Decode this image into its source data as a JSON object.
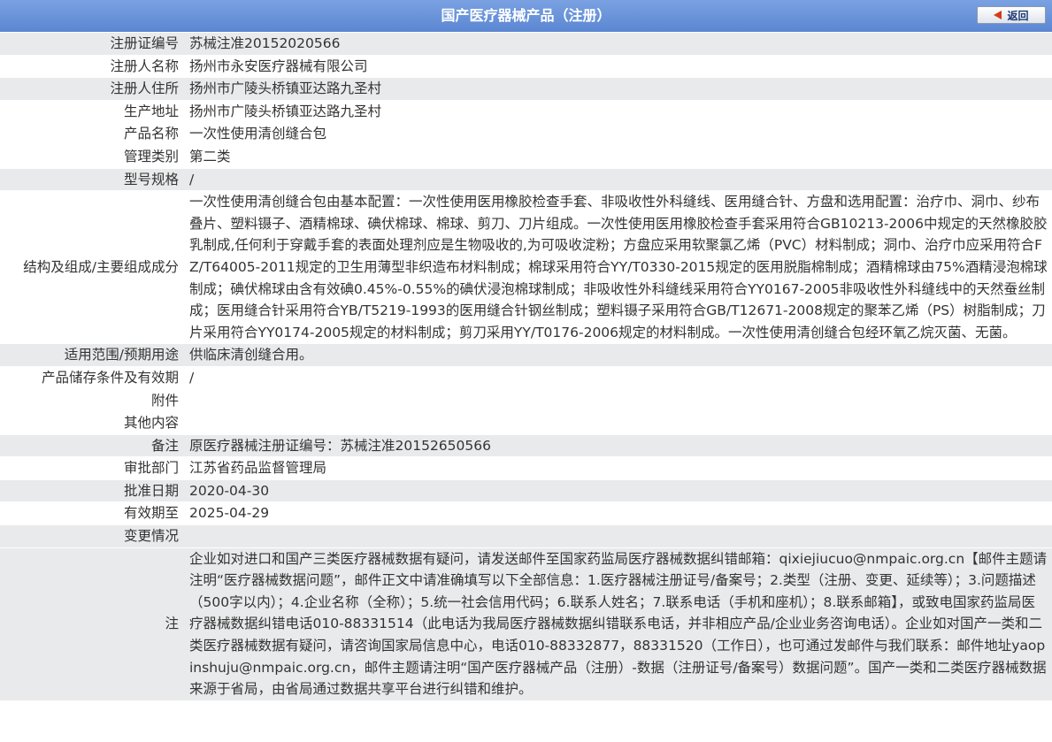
{
  "header": {
    "title": "国产医疗器械产品（注册）",
    "back_label": "返回"
  },
  "fields": [
    {
      "label": "注册证编号",
      "value": "苏械注准20152020566"
    },
    {
      "label": "注册人名称",
      "value": "扬州市永安医疗器械有限公司"
    },
    {
      "label": "注册人住所",
      "value": "扬州市广陵头桥镇亚达路九圣村"
    },
    {
      "label": "生产地址",
      "value": "扬州市广陵头桥镇亚达路九圣村"
    },
    {
      "label": "产品名称",
      "value": "一次性使用清创缝合包"
    },
    {
      "label": "管理类别",
      "value": "第二类"
    },
    {
      "label": "型号规格",
      "value": "/"
    },
    {
      "label": "结构及组成/主要组成成分",
      "value": "一次性使用清创缝合包由基本配置：一次性使用医用橡胶检查手套、非吸收性外科缝线、医用缝合针、方盘和选用配置：治疗巾、洞巾、纱布叠片、塑料镊子、酒精棉球、碘伏棉球、棉球、剪刀、刀片组成。一次性使用医用橡胶检查手套采用符合GB10213-2006中规定的天然橡胶胶乳制成,任何利于穿戴手套的表面处理剂应是生物吸收的,为可吸收淀粉；方盘应采用软聚氯乙烯（PVC）材料制成；洞巾、治疗巾应采用符合FZ/T64005-2011规定的卫生用薄型非织造布材料制成；棉球采用符合YY/T0330-2015规定的医用脱脂棉制成；酒精棉球由75%酒精浸泡棉球制成；碘伏棉球由含有效碘0.45%-0.55%的碘伏浸泡棉球制成；非吸收性外科缝线采用符合YY0167-2005非吸收性外科缝线中的天然蚕丝制成；医用缝合针采用符合YB/T5219-1993的医用缝合针钢丝制成；塑料镊子采用符合GB/T12671-2008规定的聚苯乙烯（PS）树脂制成；刀片采用符合YY0174-2005规定的材料制成；剪刀采用YY/T0176-2006规定的材料制成。一次性使用清创缝合包经环氧乙烷灭菌、无菌。"
    },
    {
      "label": "适用范围/预期用途",
      "value": "供临床清创缝合用。"
    },
    {
      "label": "产品储存条件及有效期",
      "value": "/"
    },
    {
      "label": "附件",
      "value": ""
    },
    {
      "label": "其他内容",
      "value": ""
    },
    {
      "label": "备注",
      "value": "原医疗器械注册证编号：苏械注准20152650566"
    },
    {
      "label": "审批部门",
      "value": "江苏省药品监督管理局"
    },
    {
      "label": "批准日期",
      "value": "2020-04-30"
    },
    {
      "label": "有效期至",
      "value": "2025-04-29"
    },
    {
      "label": "变更情况",
      "value": ""
    }
  ],
  "note": {
    "label": "注",
    "text": "企业如对进口和国产三类医疗器械数据有疑问，请发送邮件至国家药监局医疗器械数据纠错邮箱：qixiejiucuo@nmpaic.org.cn【邮件主题请注明“医疗器械数据问题”，邮件正文中请准确填写以下全部信息：1.医疗器械注册证号/备案号；2.类型（注册、变更、延续等）；3.问题描述（500字以内）；4.企业名称（全称）；5.统一社会信用代码；6.联系人姓名；7.联系电话（手机和座机）；8.联系邮箱】，或致电国家药监局医疗器械数据纠错电话010-88331514（此电话为我局医疗器械数据纠错联系电话，并非相应产品/企业业务咨询电话）。企业如对国产一类和二类医疗器械数据有疑问，请咨询国家局信息中心，电话010-88332877，88331520（工作日），也可通过发邮件与我们联系：邮件地址yaopinshuju@nmpaic.org.cn，邮件主题请注明“国产医疗器械产品（注册）-数据（注册证号/备案号）数据问题”。国产一类和二类医疗器械数据来源于省局，由省局通过数据共享平台进行纠错和维护。"
  },
  "colors": {
    "header_bg": "#6690d8",
    "row_alt_bg": "#e9eaeb",
    "text": "#333333"
  }
}
